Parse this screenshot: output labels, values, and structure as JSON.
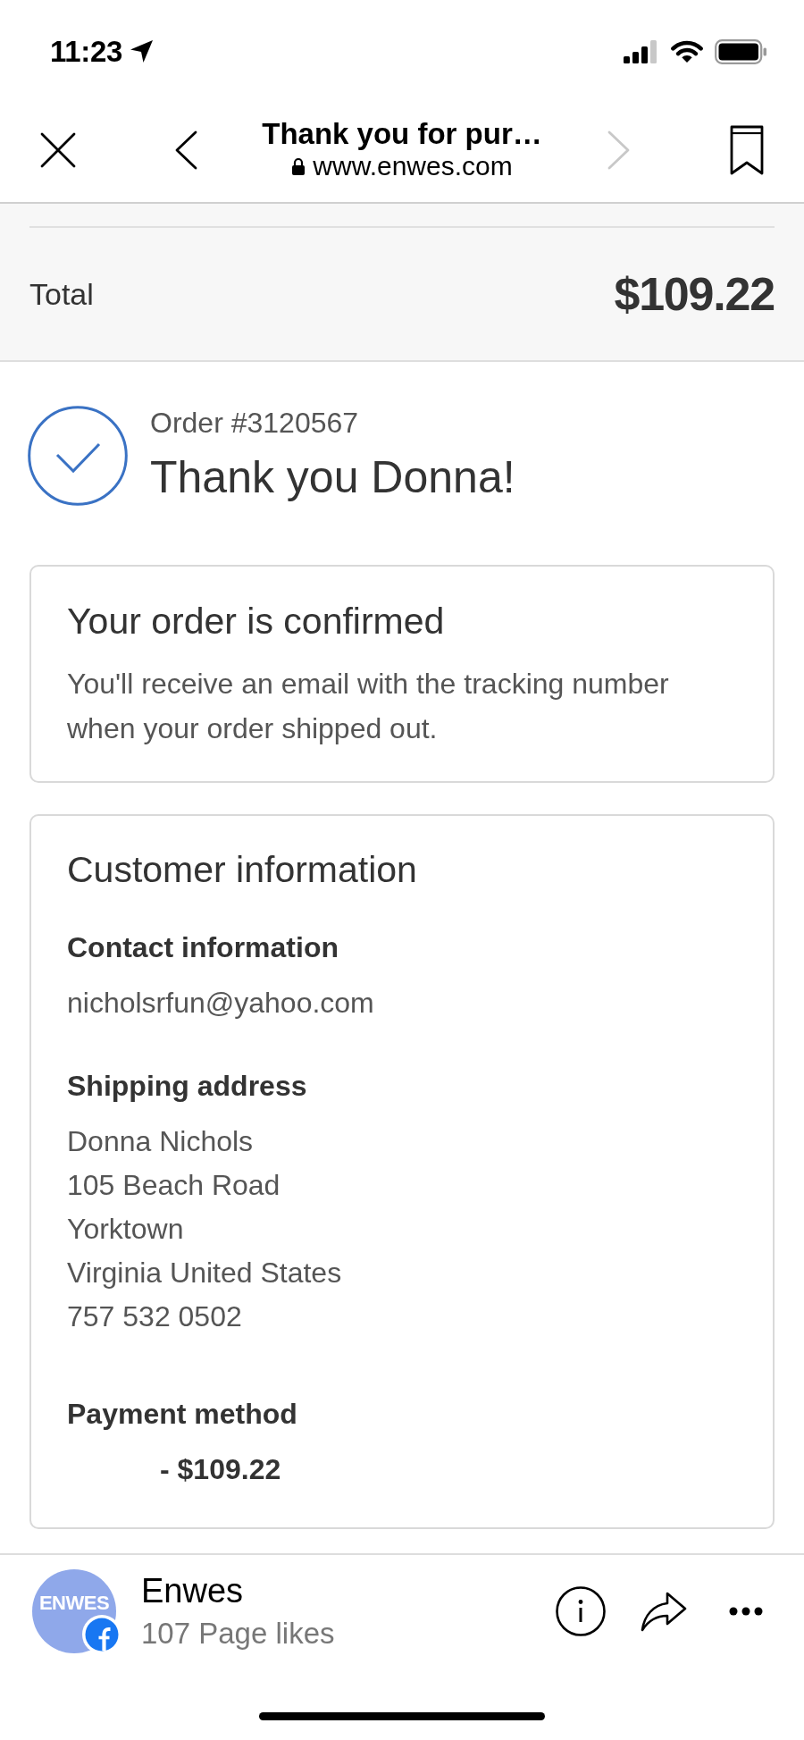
{
  "status_bar": {
    "time": "11:23"
  },
  "browser_bar": {
    "title": "Thank you for pur…",
    "url": "www.enwes.com",
    "forward_button": {
      "disabled": true
    }
  },
  "total": {
    "label": "Total",
    "amount": "$109.22"
  },
  "order": {
    "number": "Order #3120567",
    "greeting": "Thank you Donna!"
  },
  "confirmation_card": {
    "title": "Your order is confirmed",
    "text": "You'll receive an email with the tracking number when your order shipped out."
  },
  "customer_card": {
    "title": "Customer information",
    "sections": [
      {
        "kind": "contact",
        "heading": "Contact information",
        "lines": [
          "nicholsrfun@yahoo.com"
        ]
      },
      {
        "kind": "address",
        "heading": "Shipping address",
        "lines": [
          "Donna Nichols",
          "105 Beach Road",
          "Yorktown",
          "Virginia United States",
          "757 532 0502"
        ]
      },
      {
        "kind": "payment",
        "heading": "Payment method",
        "lines": [
          "- $109.22"
        ]
      }
    ]
  },
  "page_bar": {
    "avatar_text": "ENWES",
    "name": "Enwes",
    "likes": "107 Page likes"
  }
}
